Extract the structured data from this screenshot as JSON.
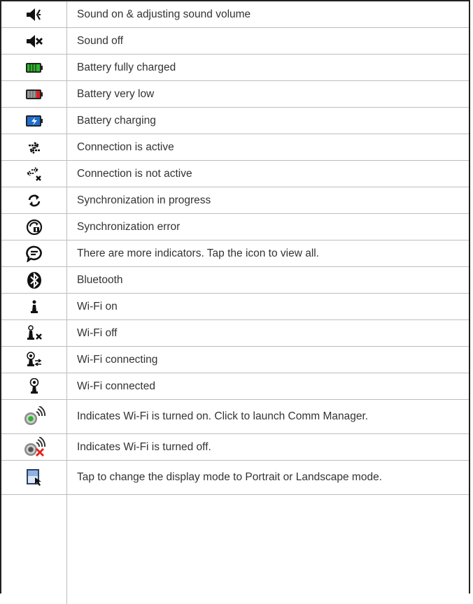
{
  "rows": [
    {
      "icon": "sound-on-icon",
      "label": "Sound on & adjusting sound volume"
    },
    {
      "icon": "sound-off-icon",
      "label": "Sound off"
    },
    {
      "icon": "battery-full-icon",
      "label": "Battery fully charged"
    },
    {
      "icon": "battery-low-icon",
      "label": "Battery very low"
    },
    {
      "icon": "battery-charging-icon",
      "label": "Battery charging"
    },
    {
      "icon": "connection-active-icon",
      "label": "Connection is active"
    },
    {
      "icon": "connection-inactive-icon",
      "label": "Connection is not active"
    },
    {
      "icon": "sync-icon",
      "label": "Synchronization in progress"
    },
    {
      "icon": "sync-error-icon",
      "label": "Synchronization error"
    },
    {
      "icon": "more-indicators-icon",
      "label": "There are more indicators. Tap the icon to view all."
    },
    {
      "icon": "bluetooth-icon",
      "label": "Bluetooth"
    },
    {
      "icon": "wifi-on-icon",
      "label": "Wi-Fi on"
    },
    {
      "icon": "wifi-off-icon",
      "label": "Wi-Fi off"
    },
    {
      "icon": "wifi-connecting-icon",
      "label": "Wi-Fi connecting"
    },
    {
      "icon": "wifi-connected-icon",
      "label": "Wi-Fi connected"
    },
    {
      "icon": "comm-manager-wifi-on-icon",
      "label": "Indicates Wi-Fi is turned on. Click to launch Comm Manager."
    },
    {
      "icon": "comm-manager-wifi-off-icon",
      "label": "Indicates Wi-Fi is turned off."
    },
    {
      "icon": "display-mode-icon",
      "label": "Tap to change the display mode to Portrait or Landscape mode."
    }
  ],
  "colors": {
    "border": "#bdbdbd",
    "text": "#333333",
    "battery_green": "#2db52d",
    "battery_red": "#e02020",
    "charging_blue": "#1f6fd1",
    "error_red": "#e0261e"
  }
}
